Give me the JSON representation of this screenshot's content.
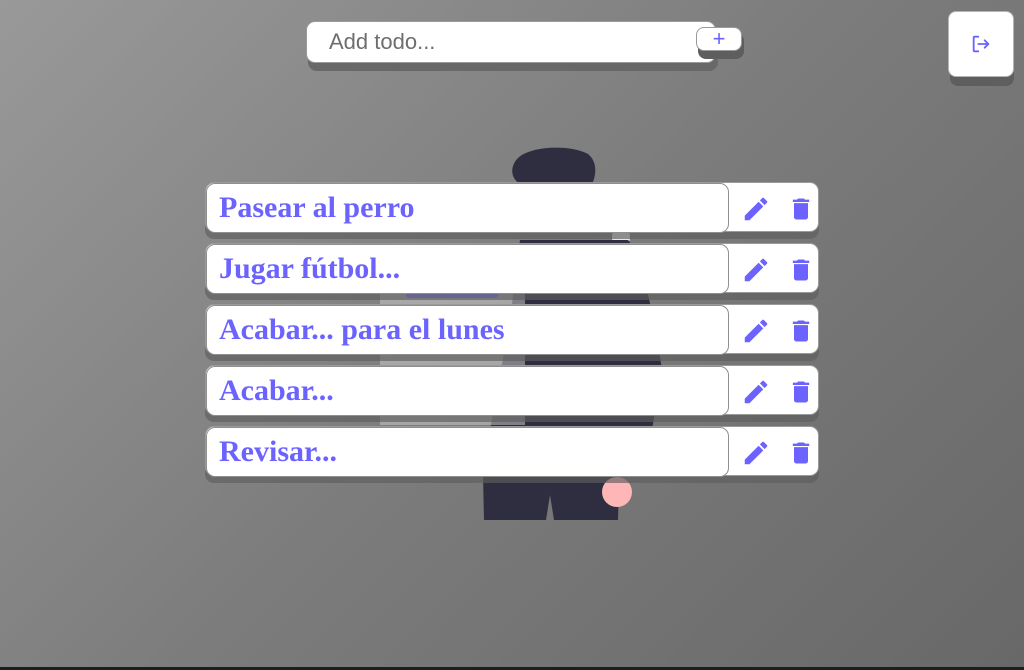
{
  "add_form": {
    "placeholder": "Add todo...",
    "value": "",
    "add_button_label": "+"
  },
  "logout": {
    "icon": "logout-icon"
  },
  "todos": [
    {
      "text": "Pasear al perro"
    },
    {
      "text": "Jugar fútbol..."
    },
    {
      "text": "Acabar... para el lunes"
    },
    {
      "text": "Acabar..."
    },
    {
      "text": "Revisar..."
    }
  ],
  "icons": {
    "edit": "pencil-icon",
    "delete": "trash-icon"
  },
  "colors": {
    "accent": "#6c63ff",
    "illustration_dark": "#2f2e41",
    "illustration_skin": "#ffb6b6",
    "card": "#ffffff"
  }
}
